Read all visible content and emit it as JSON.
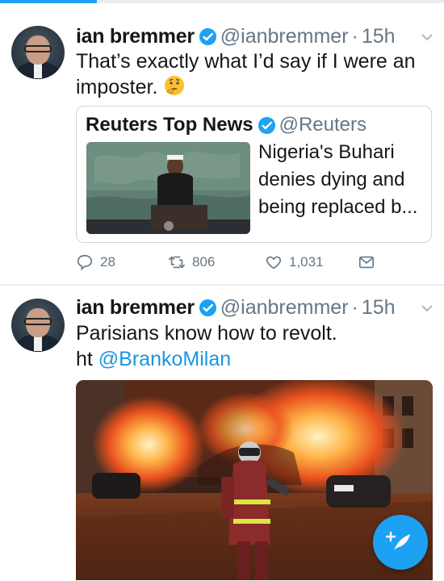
{
  "colors": {
    "accent": "#1da1f2",
    "link": "#1b95e0",
    "text": "#14171a",
    "secondary": "#657786",
    "border": "#ccd6dd"
  },
  "tweets": [
    {
      "author": {
        "name": "ian bremmer",
        "handle": "@ianbremmer",
        "verified": true,
        "avatar_icon": "profile-photo"
      },
      "separator": "·",
      "time": "15h",
      "text": "That’s exactly what I’d say if I were an imposter.",
      "emoji": "thinking-face",
      "quoted": {
        "name": "Reuters Top News",
        "handle": "@Reuters",
        "verified": true,
        "text": "Nigeria's Buhari denies dying and being replaced b..."
      },
      "actions": {
        "replies": "28",
        "retweets": "806",
        "likes": "1,031"
      }
    },
    {
      "author": {
        "name": "ian bremmer",
        "handle": "@ianbremmer",
        "verified": true,
        "avatar_icon": "profile-photo"
      },
      "separator": "·",
      "time": "15h",
      "text_line1": "Parisians know how to revolt.",
      "text_line2_prefix": "ht ",
      "mention": "@BrankoMilan",
      "media": "photo-burning-cars-firefighter"
    }
  ],
  "fab": {
    "icon": "compose-tweet-icon"
  }
}
